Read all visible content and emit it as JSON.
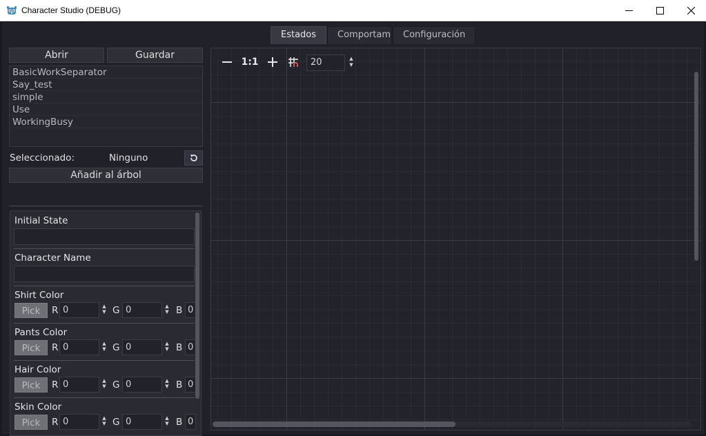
{
  "window": {
    "title": "Character Studio (DEBUG)",
    "controls": [
      "minimize-icon",
      "maximize-icon",
      "close-icon"
    ]
  },
  "tabs": [
    {
      "label": "Estados",
      "active": true
    },
    {
      "label": "Comportamiento",
      "active": false
    },
    {
      "label": "Configuración",
      "active": false
    }
  ],
  "toolbar": {
    "open_label": "Abrir",
    "save_label": "Guardar"
  },
  "state_list": [
    "BasicWorkSeparator",
    "Say_test",
    "simple",
    "Use",
    "WorkingBusy"
  ],
  "selection": {
    "label": "Seleccionado:",
    "value": "Ninguno",
    "add_label": "Añadir al árbol"
  },
  "inspector": {
    "initial_state_label": "Initial State",
    "initial_state_value": "",
    "character_name_label": "Character Name",
    "character_name_value": "",
    "colors": [
      {
        "label": "Shirt Color",
        "pick": "Pick",
        "r": "0",
        "g": "0",
        "b": "0"
      },
      {
        "label": "Pants Color",
        "pick": "Pick",
        "r": "0",
        "g": "0",
        "b": "0"
      },
      {
        "label": "Hair Color",
        "pick": "Pick",
        "r": "0",
        "g": "0",
        "b": "0"
      },
      {
        "label": "Skin Color",
        "pick": "Pick",
        "r": "0",
        "g": "0",
        "b": "0"
      }
    ],
    "channel_labels": {
      "r": "R",
      "g": "G",
      "b": "B"
    }
  },
  "graph": {
    "zoom_reset_label": "1:1",
    "snap_value": "20"
  },
  "colors": {
    "accent": "#478cbf",
    "background": "#21212a",
    "panel": "#2a2a33"
  }
}
